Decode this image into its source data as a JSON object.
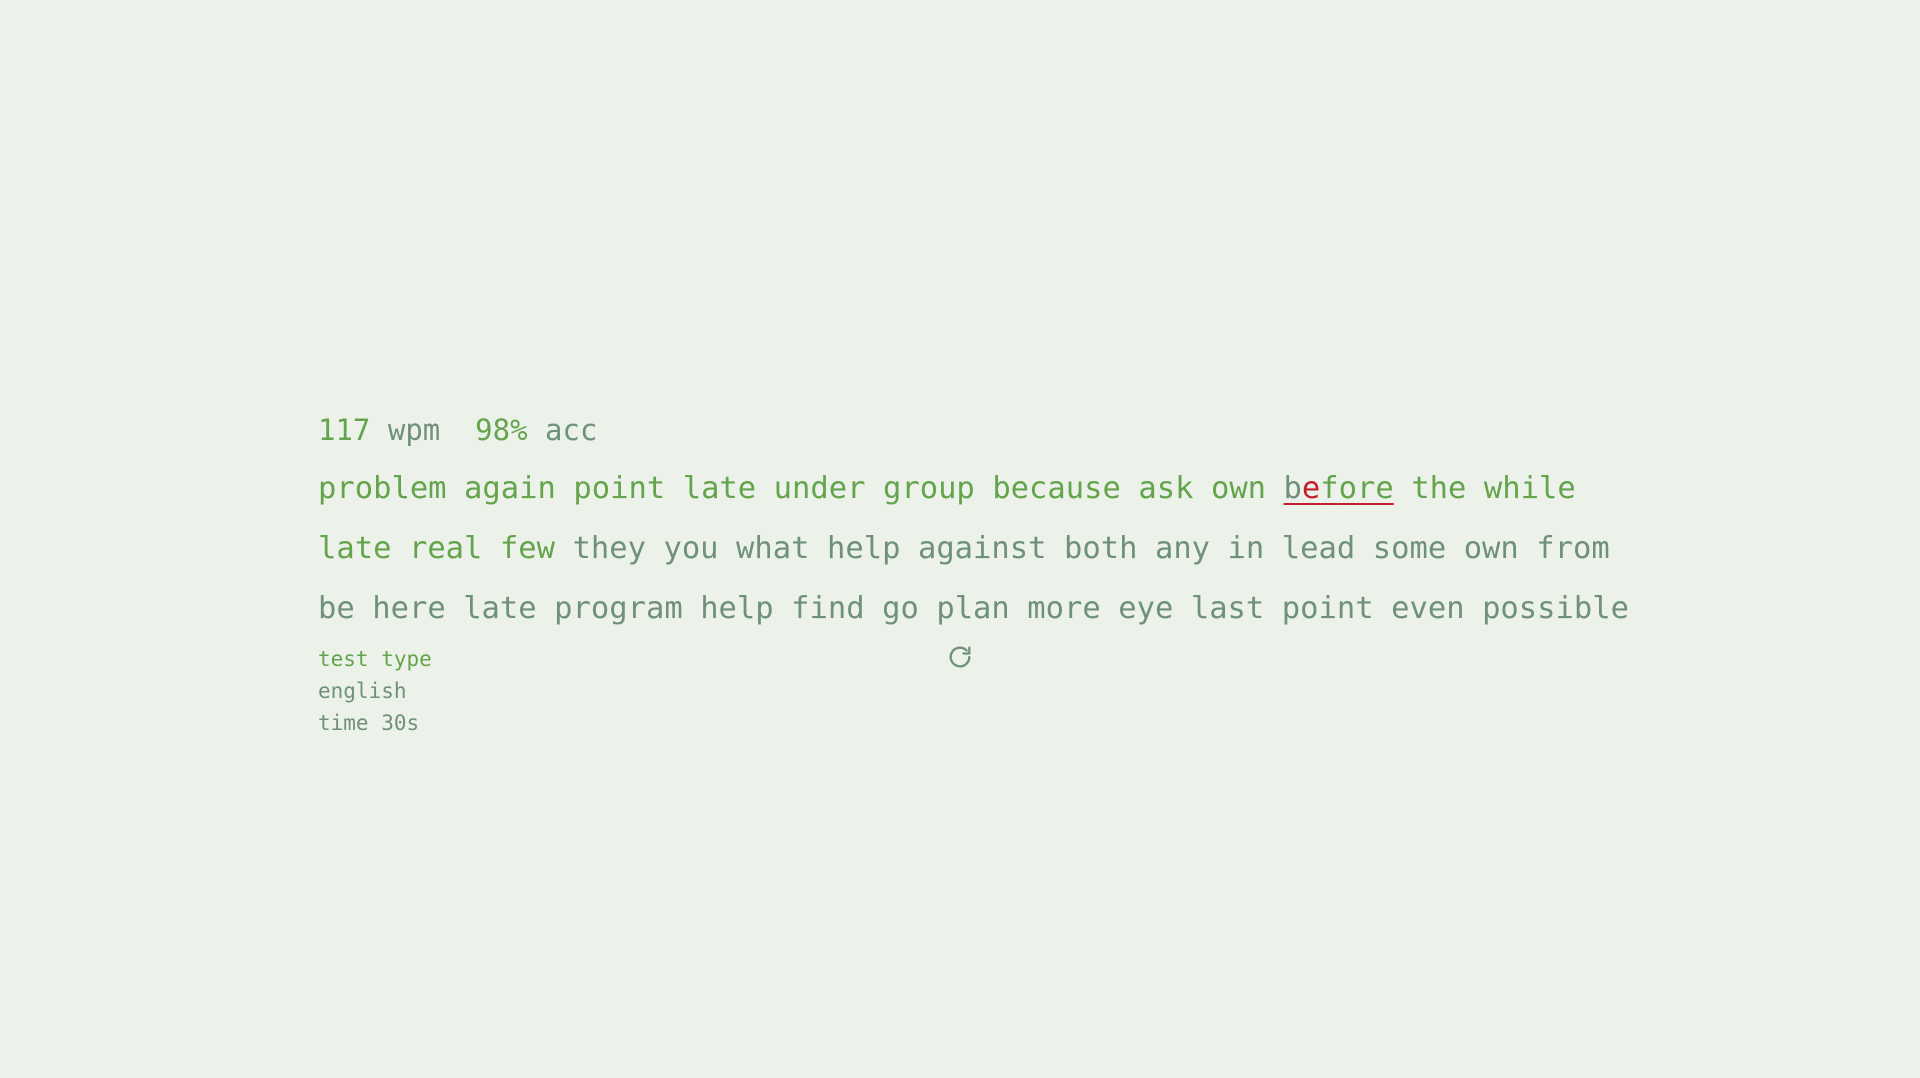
{
  "stats": {
    "wpm_value": "117",
    "wpm_unit": "wpm",
    "acc_value": "98%",
    "acc_unit": "acc"
  },
  "colors": {
    "background": "#ecf2ea",
    "typed_correct": "#64a44c",
    "untyped": "#709179",
    "error": "#c51f2b"
  },
  "lines": [
    [
      {
        "text": "problem",
        "state": "typed"
      },
      {
        "text": "again",
        "state": "typed"
      },
      {
        "text": "point",
        "state": "typed"
      },
      {
        "text": "late",
        "state": "typed"
      },
      {
        "text": "under",
        "state": "typed"
      },
      {
        "text": "group",
        "state": "typed"
      },
      {
        "text": "because",
        "state": "typed"
      },
      {
        "text": "ask",
        "state": "typed"
      },
      {
        "text": "own",
        "state": "typed"
      },
      {
        "text": "before",
        "state": "error",
        "letters": [
          {
            "ch": "b",
            "state": "untyped"
          },
          {
            "ch": "e",
            "state": "incorrect"
          },
          {
            "ch": "f",
            "state": "correct"
          },
          {
            "ch": "o",
            "state": "correct"
          },
          {
            "ch": "r",
            "state": "correct"
          },
          {
            "ch": "e",
            "state": "correct"
          }
        ]
      },
      {
        "text": "the",
        "state": "typed"
      },
      {
        "text": "while",
        "state": "typed"
      }
    ],
    [
      {
        "text": "late",
        "state": "typed"
      },
      {
        "text": "real",
        "state": "typed"
      },
      {
        "text": "few",
        "state": "typed"
      },
      {
        "text": "they",
        "state": "untyped"
      },
      {
        "text": "you",
        "state": "untyped"
      },
      {
        "text": "what",
        "state": "untyped"
      },
      {
        "text": "help",
        "state": "untyped"
      },
      {
        "text": "against",
        "state": "untyped"
      },
      {
        "text": "both",
        "state": "untyped"
      },
      {
        "text": "any",
        "state": "untyped"
      },
      {
        "text": "in",
        "state": "untyped"
      },
      {
        "text": "lead",
        "state": "untyped"
      },
      {
        "text": "some",
        "state": "untyped"
      },
      {
        "text": "own",
        "state": "untyped"
      },
      {
        "text": "from",
        "state": "untyped"
      }
    ],
    [
      {
        "text": "be",
        "state": "untyped"
      },
      {
        "text": "here",
        "state": "untyped"
      },
      {
        "text": "late",
        "state": "untyped"
      },
      {
        "text": "program",
        "state": "untyped"
      },
      {
        "text": "help",
        "state": "untyped"
      },
      {
        "text": "find",
        "state": "untyped"
      },
      {
        "text": "go",
        "state": "untyped"
      },
      {
        "text": "plan",
        "state": "untyped"
      },
      {
        "text": "more",
        "state": "untyped"
      },
      {
        "text": "eye",
        "state": "untyped"
      },
      {
        "text": "last",
        "state": "untyped"
      },
      {
        "text": "point",
        "state": "untyped"
      },
      {
        "text": "even",
        "state": "untyped"
      },
      {
        "text": "possible",
        "state": "untyped"
      }
    ]
  ],
  "config": {
    "test_type_label": "test type",
    "language": "english",
    "time": "time 30s"
  },
  "restart": {
    "icon": "restart-icon"
  }
}
